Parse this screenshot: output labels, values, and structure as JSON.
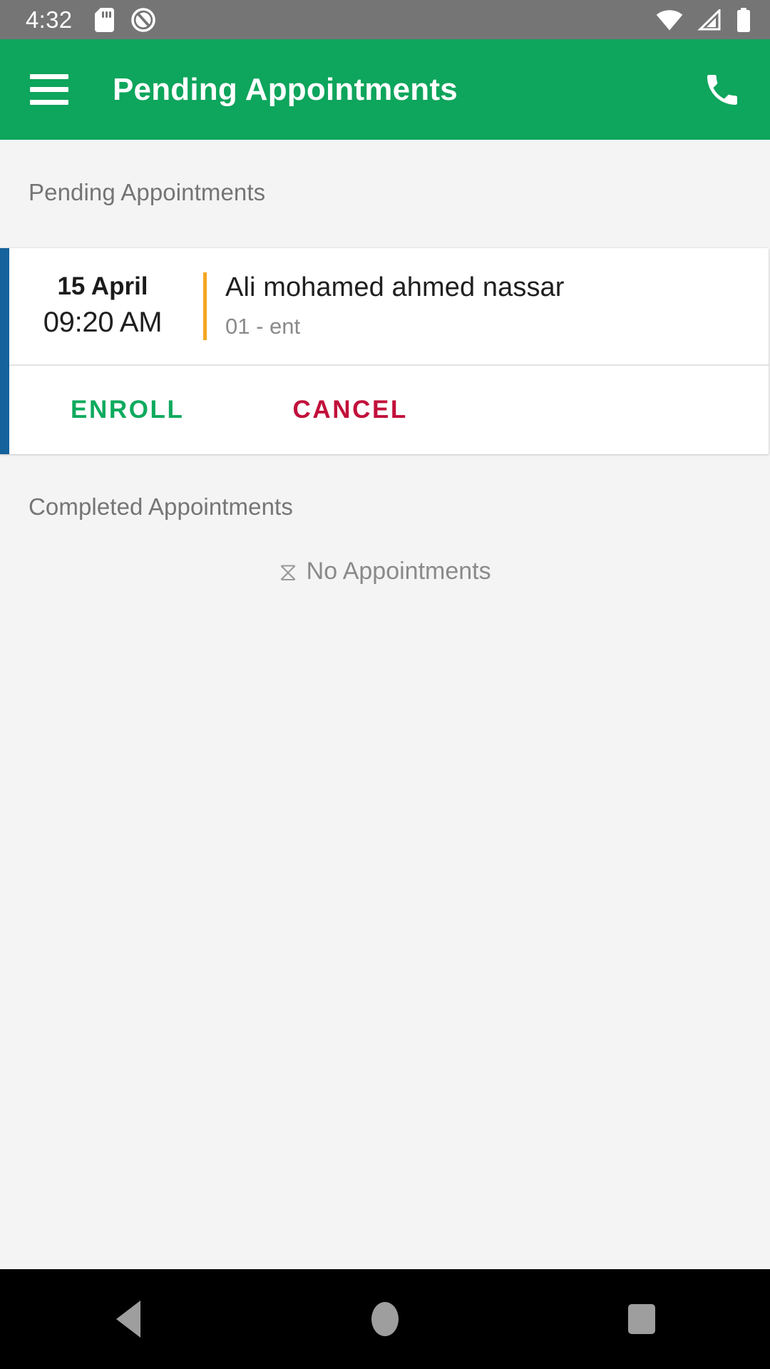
{
  "status_bar": {
    "time": "4:32",
    "left_icons": [
      "sd-card-icon",
      "do-not-disturb-icon"
    ],
    "right_icons": [
      "wifi-icon",
      "cell-signal-icon",
      "battery-icon"
    ],
    "background": "#757575"
  },
  "app_bar": {
    "title": "Pending Appointments",
    "menu_icon": "hamburger-menu-icon",
    "call_icon": "phone-icon",
    "background": "#0ea55c",
    "foreground": "#ffffff"
  },
  "sections": {
    "pending": {
      "header": "Pending Appointments"
    },
    "completed": {
      "header": "Completed Appointments",
      "empty_icon": "hourglass-icon",
      "empty_glyph": "⧖",
      "empty_text": "No Appointments"
    }
  },
  "appointment": {
    "date": "15 April",
    "time": "09:20 AM",
    "patient_name": "Ali mohamed ahmed nassar",
    "details": "01 - ent",
    "accent_color": "#15629c",
    "separator_color": "#f5a623",
    "enroll_label": "ENROLL",
    "cancel_label": "CANCEL",
    "enroll_color": "#0eaa5e",
    "cancel_color": "#c2103b"
  },
  "nav_bar": {
    "back": "back-triangle-icon",
    "home": "home-circle-icon",
    "recents": "recents-square-icon",
    "background": "#000000"
  }
}
